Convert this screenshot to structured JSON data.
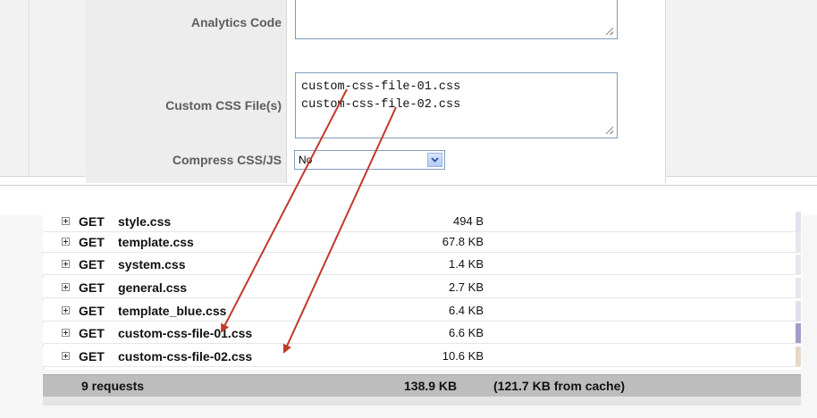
{
  "settings_form": {
    "analytics_code": {
      "label": "Analytics Code",
      "value": ""
    },
    "custom_css": {
      "label": "Custom CSS File(s)",
      "value": "custom-css-file-01.css\ncustom-css-file-02.css"
    },
    "compress": {
      "label": "Compress CSS/JS",
      "selected": "No"
    }
  },
  "network_list": {
    "requests": [
      {
        "method": "GET",
        "name": "style.css",
        "size": "494 B",
        "bar_color": "#e2e2ee"
      },
      {
        "method": "GET",
        "name": "template.css",
        "size": "67.8 KB",
        "bar_color": "#e6e6ee"
      },
      {
        "method": "GET",
        "name": "system.css",
        "size": "1.4 KB",
        "bar_color": "#e6e6ee"
      },
      {
        "method": "GET",
        "name": "general.css",
        "size": "2.7 KB",
        "bar_color": "#e6e6ee"
      },
      {
        "method": "GET",
        "name": "template_blue.css",
        "size": "6.4 KB",
        "bar_color": "#e0e0ec"
      },
      {
        "method": "GET",
        "name": "custom-css-file-01.css",
        "size": "6.6 KB",
        "bar_color": "#a89ac8"
      },
      {
        "method": "GET",
        "name": "custom-css-file-02.css",
        "size": "10.6 KB",
        "bar_color": "#e8d8c8"
      }
    ],
    "summary": {
      "count": "9 requests",
      "total": "138.9 KB",
      "cached": "(121.7 KB from cache)"
    }
  },
  "colors": {
    "arrow": "#c0392b",
    "summary_bg": "#bdbdbd"
  }
}
